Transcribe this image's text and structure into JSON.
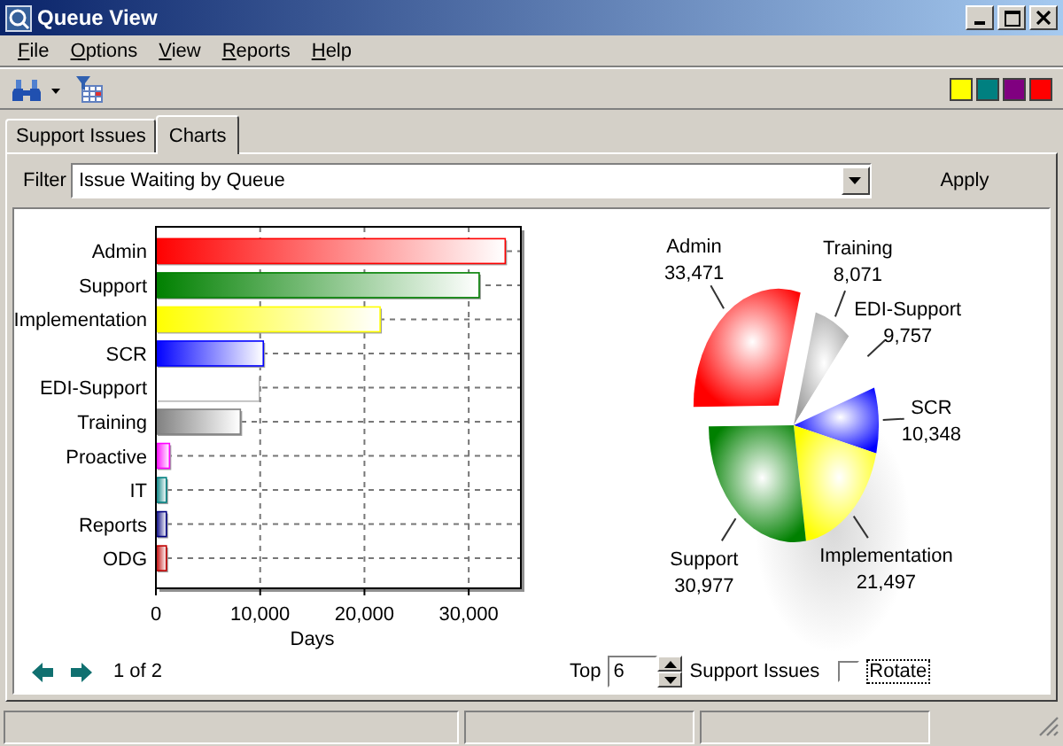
{
  "window": {
    "title": "Queue View"
  },
  "menu": [
    "File",
    "Options",
    "View",
    "Reports",
    "Help"
  ],
  "toolbar": {
    "swatches": [
      {
        "color": "#ffff00"
      },
      {
        "color": "#008080"
      },
      {
        "color": "#800080"
      },
      {
        "color": "#ff0000"
      }
    ]
  },
  "tabs": [
    {
      "label": "Support Issues",
      "selected": false
    },
    {
      "label": "Charts",
      "selected": true
    }
  ],
  "filter": {
    "label": "Filter",
    "value": "Issue Waiting by Queue",
    "apply": "Apply"
  },
  "bar_chart": {
    "chart_data": {
      "type": "bar",
      "orientation": "horizontal",
      "xlabel": "Days",
      "categories": [
        "Admin",
        "Support",
        "Implementation",
        "SCR",
        "EDI-Support",
        "Training",
        "Proactive",
        "IT",
        "Reports",
        "ODG"
      ],
      "values": [
        33500,
        31000,
        21500,
        10300,
        9800,
        8100,
        1300,
        1000,
        1000,
        1000
      ],
      "grid": true,
      "colors": [
        "#ff0000",
        "#008000",
        "#ffff00",
        "#0000ff",
        "#ffffff",
        "#808080",
        "#ff00ff",
        "#008080",
        "#000080",
        "#c00000"
      ],
      "xlim": [
        0,
        35000
      ],
      "xticks": [
        {
          "value": 0,
          "label": "0"
        },
        {
          "value": 10000,
          "label": "10,000"
        },
        {
          "value": 20000,
          "label": "20,000"
        },
        {
          "value": 30000,
          "label": "30,000"
        }
      ]
    }
  },
  "pie_chart": {
    "chart_data": {
      "type": "pie",
      "categories": [
        "Training",
        "EDI-Support",
        "SCR",
        "Implementation",
        "Support",
        "Admin"
      ],
      "values": [
        8071,
        9757,
        10348,
        21497,
        30977,
        33471
      ],
      "colors": [
        "#a0a0a0",
        "#ffffff",
        "#0000ff",
        "#ffff00",
        "#008000",
        "#ff0000"
      ],
      "value_labels": [
        "8,071",
        "9,757",
        "10,348",
        "21,497",
        "30,977",
        "33,471"
      ]
    }
  },
  "footer": {
    "page": "1 of 2",
    "top_label": "Top",
    "top_value": "6",
    "unit": "Support Issues",
    "rotate": {
      "label": "Rotate",
      "checked": false
    }
  }
}
